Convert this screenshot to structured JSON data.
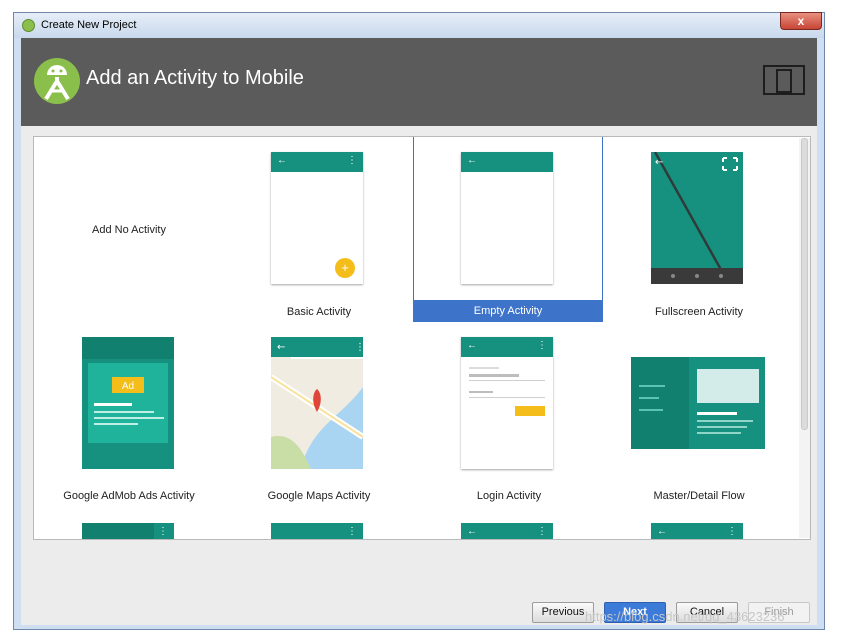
{
  "window": {
    "title": "Create New Project",
    "close_glyph": "x"
  },
  "header": {
    "title": "Add an Activity to Mobile",
    "logo_icon": "android-studio-logo-icon",
    "device_icon": "tablet-phone-icon"
  },
  "gallery": {
    "tiles": [
      {
        "label": "Add No Activity"
      },
      {
        "label": "Basic Activity"
      },
      {
        "label": "Empty Activity",
        "selected": true
      },
      {
        "label": "Fullscreen Activity"
      },
      {
        "label": "Google AdMob Ads Activity",
        "ad_badge": "Ad"
      },
      {
        "label": "Google Maps Activity"
      },
      {
        "label": "Login Activity"
      },
      {
        "label": "Master/Detail Flow"
      }
    ]
  },
  "glyphs": {
    "back": "←",
    "menu": "⋮",
    "plus": "+"
  },
  "buttons": {
    "previous": "Previous",
    "next": "Next",
    "cancel": "Cancel",
    "finish": "Finish"
  },
  "watermark": "https://blog.csdn.net/qq_43623236",
  "colors": {
    "accent": "#17917f",
    "selection": "#3d73c9",
    "header": "#5b5b5b",
    "fab": "#f4bd1a"
  }
}
